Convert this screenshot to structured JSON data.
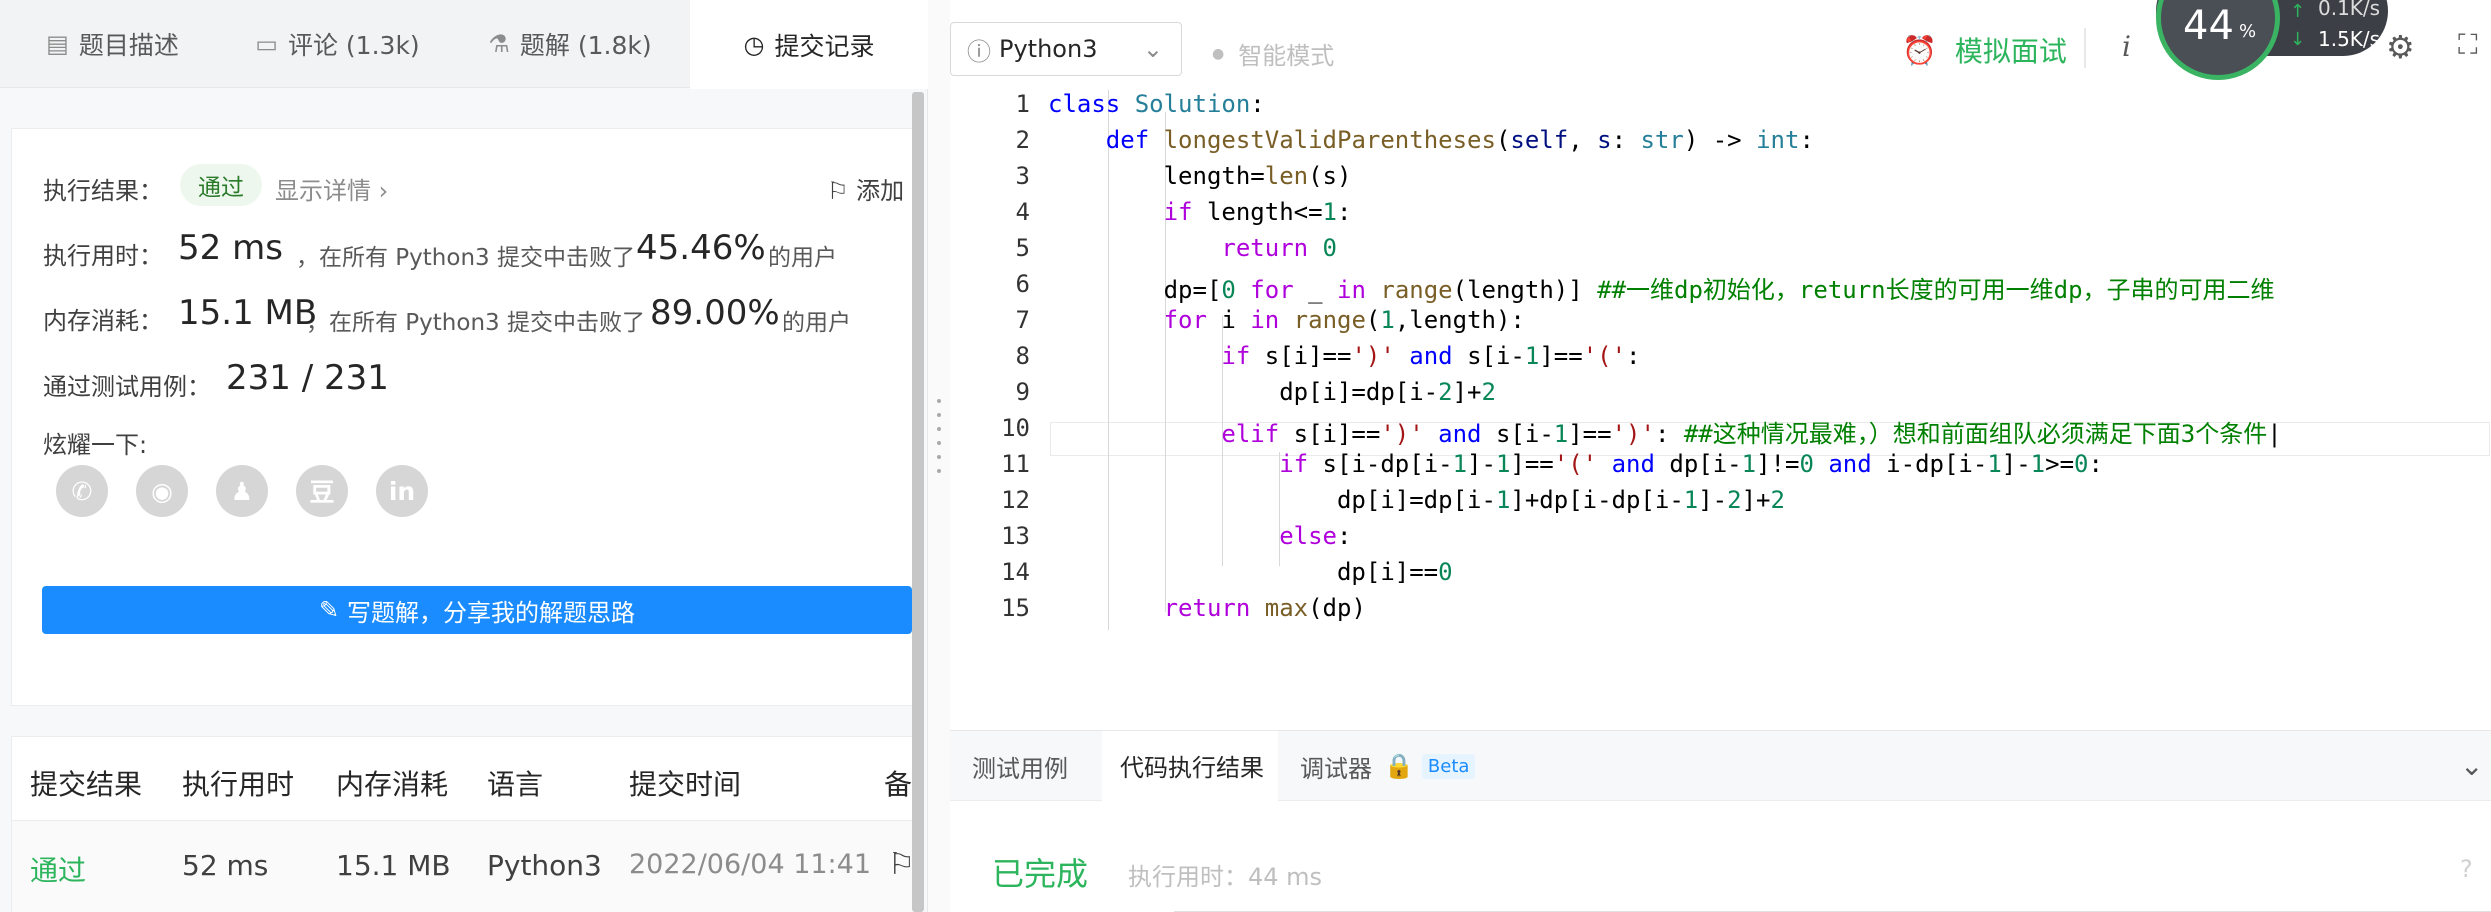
{
  "left_tabs": [
    {
      "label": "题目描述",
      "icon": "description-icon"
    },
    {
      "label": "评论 (1.3k)",
      "icon": "comment-icon"
    },
    {
      "label": "题解 (1.8k)",
      "icon": "flask-icon"
    },
    {
      "label": "提交记录",
      "icon": "clock-icon"
    }
  ],
  "result": {
    "exec_label": "执行结果：",
    "status": "通过",
    "detail_link": "显示详情 ›",
    "add_label": "添加",
    "time_label": "执行用时：",
    "time_value": "52 ms",
    "time_text": "，在所有 Python3 提交中击败了",
    "time_pct": "45.46%",
    "users_text": "的用户",
    "mem_label": "内存消耗：",
    "mem_value": "15.1 MB",
    "mem_text": "，在所有 Python3 提交中击败了",
    "mem_pct": "89.00%",
    "tests_label": "通过测试用例：",
    "tests_value": "231 / 231",
    "share_label": "炫耀一下:",
    "share_icons": [
      "wechat-icon",
      "weibo-icon",
      "qq-icon",
      "douban-icon",
      "linkedin-icon"
    ],
    "share_glyphs": [
      "✆",
      "◉",
      "♟",
      "豆",
      "in"
    ],
    "write_button": "写题解，分享我的解题思路"
  },
  "submissions": {
    "headers": [
      "提交结果",
      "执行用时",
      "内存消耗",
      "语言",
      "提交时间",
      "备"
    ],
    "rows": [
      {
        "result": "通过",
        "time": "52 ms",
        "memory": "15.1 MB",
        "language": "Python3",
        "submitted": "2022/06/04 11:41"
      }
    ]
  },
  "editor": {
    "language": "Python3",
    "smart_mode": "智能模式",
    "mock_interview": "模拟面试",
    "info_label": "i",
    "net_percent": "44",
    "net_up": "0.1K/s",
    "net_down": "1.5K/s",
    "line_numbers": [
      "1",
      "2",
      "3",
      "4",
      "5",
      "6",
      "7",
      "8",
      "9",
      "10",
      "11",
      "12",
      "13",
      "14",
      "15"
    ]
  },
  "bottom": {
    "tabs": [
      "测试用例",
      "代码执行结果",
      "调试器"
    ],
    "beta": "Beta",
    "done": "已完成",
    "exec_time": "执行用时：44 ms"
  },
  "colors": {
    "accent": "#1a8cff",
    "success": "#2db55d",
    "tab_bg": "#f2f3f5"
  }
}
